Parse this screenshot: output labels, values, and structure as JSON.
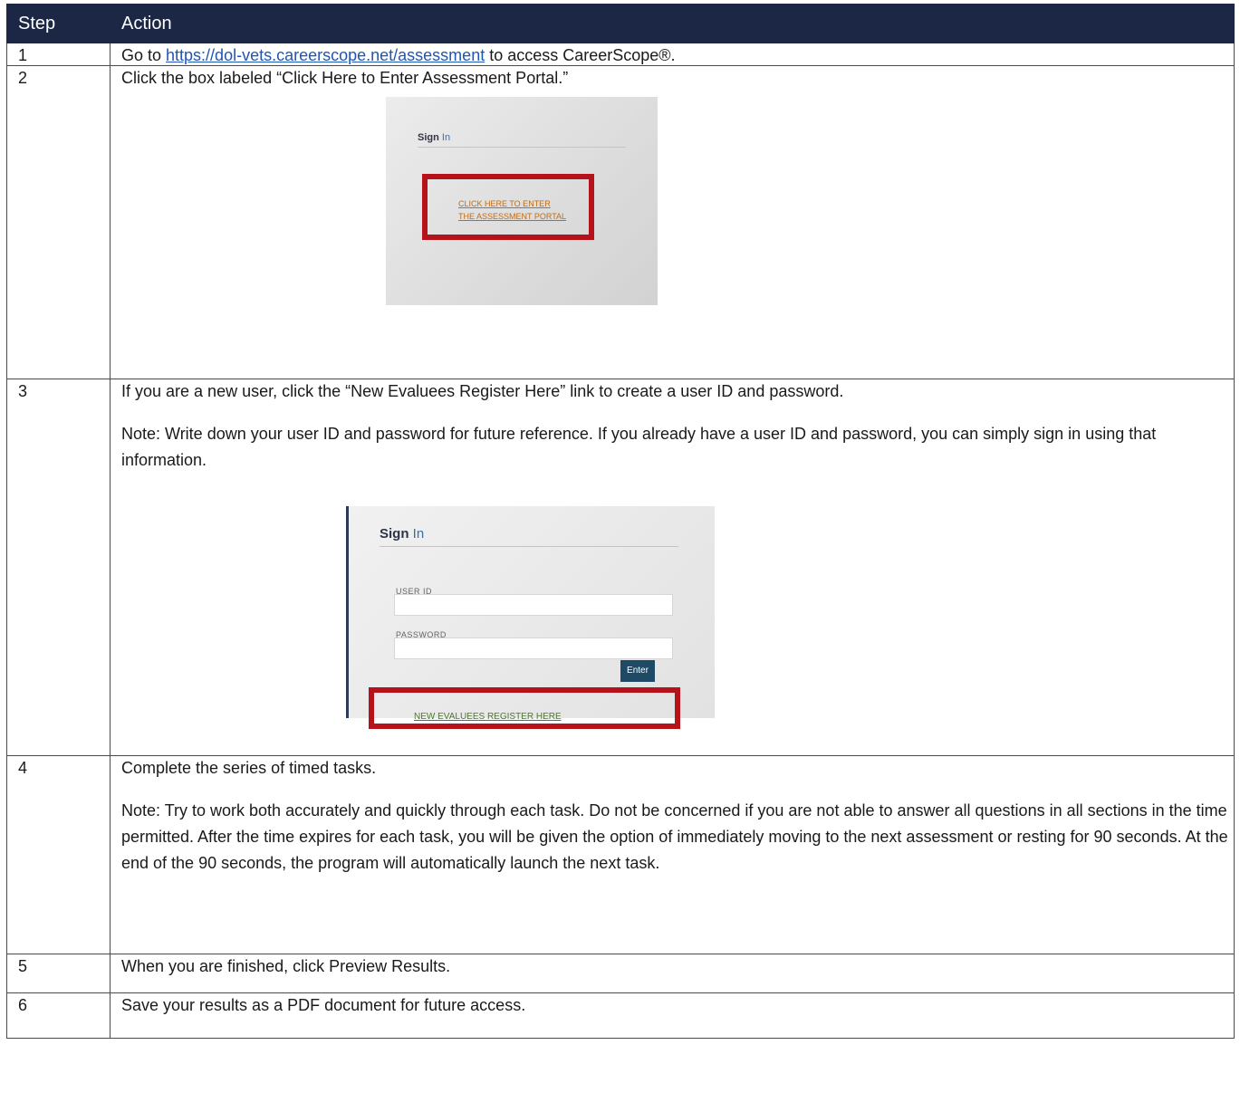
{
  "table": {
    "headers": [
      "Step",
      "Action"
    ],
    "rows": [
      {
        "num": "1",
        "pre": "Go to ",
        "link": "https://dol-vets.careerscope.net/assessment",
        "post": " to access CareerScope®."
      },
      {
        "num": "2",
        "text": "Click the box labeled “Click Here to Enter Assessment Portal.”"
      },
      {
        "num": "3",
        "text": "If you are a new user, click the “New Evaluees Register Here” link to create a user ID and password.",
        "note": "Note: Write down your user ID and password for future reference. If you already have a user ID and password, you can simply sign in using that information."
      },
      {
        "num": "4",
        "text": "Complete the series of timed tasks.",
        "note": "Note: Try to work both accurately and quickly through each task. Do not be concerned if you are not able to answer all questions in all sections in the time permitted. After the time expires for each task, you will be given the option of immediately moving to the next assessment or resting for 90 seconds. At the end of the 90 seconds, the program will automatically launch the next task."
      },
      {
        "num": "5",
        "text": "When you are finished, click Preview Results."
      },
      {
        "num": "6",
        "text": "Save your results as a PDF document for future access."
      }
    ]
  },
  "screenshot1": {
    "sign": "Sign",
    "in": "In",
    "cta_line1": "CLICK HERE TO ENTER",
    "cta_line2": "THE ASSESSMENT PORTAL"
  },
  "screenshot2": {
    "sign": "Sign",
    "in": "In",
    "userid_label": "USER ID",
    "password_label": "PASSWORD",
    "enter_button": "Enter",
    "register_link": "NEW EVALUEES REGISTER HERE"
  },
  "colors": {
    "header_bg": "#1b2745",
    "highlight_border": "#b5121b",
    "link": "#1f56b4"
  }
}
